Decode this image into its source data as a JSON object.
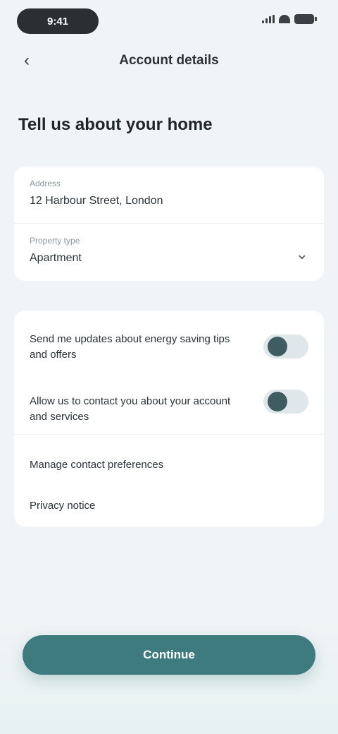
{
  "status_bar": {
    "time": "9:41"
  },
  "header": {
    "back_icon": "‹",
    "title": "Account details"
  },
  "page": {
    "title": "Tell us about your home"
  },
  "form": {
    "address": {
      "label": "Address",
      "value": "12 Harbour Street, London"
    },
    "type": {
      "label": "Property type",
      "value": "Apartment"
    }
  },
  "preferences": {
    "toggle1": {
      "label": "Send me updates about energy saving tips and offers",
      "on": true
    },
    "toggle2": {
      "label": "Allow us to contact you about your account and services",
      "on": true
    },
    "link1": "Manage contact preferences",
    "link2": "Privacy notice"
  },
  "footer": {
    "button_label": "Continue"
  },
  "colors": {
    "accent": "#3e7b7f",
    "knob": "#3f5c61",
    "background": "#f1f4f6"
  }
}
